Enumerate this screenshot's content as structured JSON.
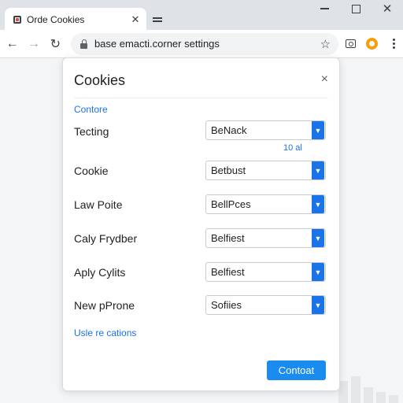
{
  "browser": {
    "tab_title": "Orde Cookies",
    "tab_close": "✕",
    "window_close": "✕",
    "url": "base emacti.corner settings",
    "back": "←",
    "forward": "→",
    "reload": "↻",
    "star": "☆"
  },
  "dialog": {
    "title": "Cookies",
    "close": "×",
    "section_link": "Contore",
    "note": "10 al",
    "rows": [
      {
        "label": "Tecting",
        "value": "BeNack"
      },
      {
        "label": "Cookie",
        "value": "Betbust"
      },
      {
        "label": "Law Poite",
        "value": "BellPces"
      },
      {
        "label": "Caly Frydber",
        "value": "Belfiest"
      },
      {
        "label": "Aply Cylits",
        "value": "Belfiest"
      },
      {
        "label": "New pProne",
        "value": "Sofiies"
      }
    ],
    "bottom_link": "Usle re cations",
    "primary_button": "Contoat"
  },
  "colors": {
    "accent": "#1a73e8",
    "button": "#1a8cf0"
  }
}
